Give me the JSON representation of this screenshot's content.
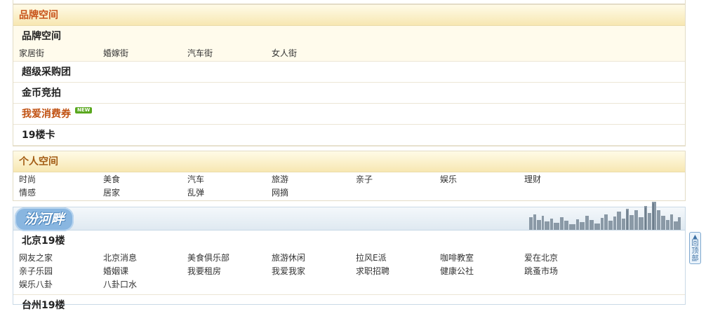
{
  "brand_space": {
    "header": "品牌空间",
    "title": "品牌空间",
    "streets": [
      "家居街",
      "婚嫁街",
      "汽车街",
      "女人街"
    ],
    "rows": [
      {
        "label": "超级采购团"
      },
      {
        "label": "金币竞拍"
      },
      {
        "label": "我爱消费券",
        "badge": "NEW"
      },
      {
        "label": "19楼卡"
      }
    ]
  },
  "personal_space": {
    "header": "个人空间",
    "links": [
      "时尚",
      "美食",
      "汽车",
      "旅游",
      "亲子",
      "娱乐",
      "理财",
      "情感",
      "居家",
      "乱弹",
      "网摘"
    ]
  },
  "city_section": {
    "logo_text": "汾河畔",
    "beijing_title": "北京19楼",
    "beijing_links": [
      "网友之家",
      "北京消息",
      "美食俱乐部",
      "旅游休闲",
      "拉风E派",
      "咖啡教室",
      "爱在北京",
      "亲子乐园",
      "婚姻课",
      "我要租房",
      "我爱我家",
      "求职招聘",
      "健康公社",
      "跳蚤市场",
      "娱乐八卦",
      "八卦口水"
    ],
    "next_title": "台州19楼"
  },
  "back_to_top": {
    "label": "回顶部",
    "arrow": "▲"
  },
  "colors": {
    "brand_header": "#c8531a",
    "personal_header": "#a35c14",
    "voucher_row": "#c05010",
    "new_badge": "#5aa81f",
    "blue_band": "#dfe9f1"
  }
}
